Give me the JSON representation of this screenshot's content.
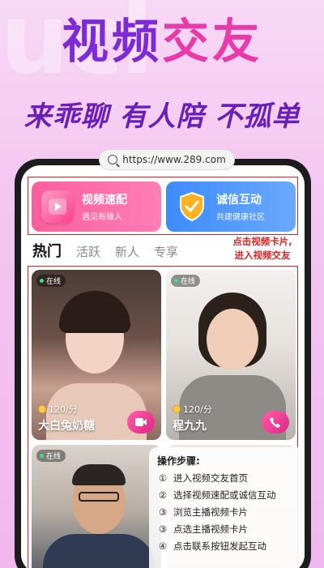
{
  "hero": {
    "title_part1": "视频",
    "title_part2": "交友",
    "subtitle": "来乖聊 有人陪 不孤单",
    "ghost_text": "ucl"
  },
  "url_bar": {
    "url": "https://www.289.com"
  },
  "features": [
    {
      "title": "视频速配",
      "subtitle": "遇见有缘人",
      "icon": "play-icon",
      "color": "#ff5e9c"
    },
    {
      "title": "诚信互动",
      "subtitle": "共建健康社区",
      "icon": "shield-icon",
      "color": "#3d8bff"
    }
  ],
  "tabs": [
    {
      "label": "热门",
      "active": true
    },
    {
      "label": "活跃",
      "active": false
    },
    {
      "label": "新人",
      "active": false
    },
    {
      "label": "专享",
      "active": false
    }
  ],
  "hint": {
    "line1": "点击视频卡片,",
    "line2": "进入视频交友"
  },
  "cards": [
    {
      "status": "在线",
      "price": "120/分",
      "name": "大白兔奶糖",
      "action_icon": "video-call-icon"
    },
    {
      "status": "在线",
      "price": "120/分",
      "name": "程九九",
      "action_icon": "phone-call-icon"
    },
    {
      "status": "在线"
    },
    {
      "status": ""
    }
  ],
  "steps": {
    "title": "操作步骤:",
    "items": [
      {
        "num": "①",
        "text": "进入视频交友首页"
      },
      {
        "num": "②",
        "text": "选择视频速配或诚信互动"
      },
      {
        "num": "③",
        "text": "浏览主播视频卡片"
      },
      {
        "num": "③",
        "text": "点选主播视频卡片"
      },
      {
        "num": "④",
        "text": "点击联系按钮发起互动"
      }
    ]
  },
  "colors": {
    "accent_pink": "#e83aa8",
    "accent_purple": "#7c2bd6",
    "annotation_red": "#d42525"
  }
}
